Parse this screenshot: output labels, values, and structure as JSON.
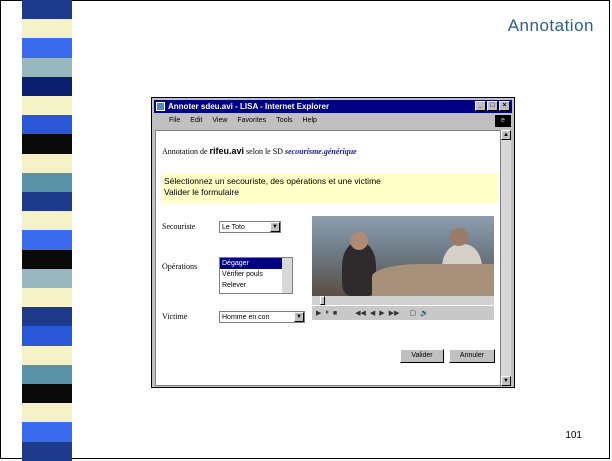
{
  "slide": {
    "title": "Annotation",
    "page_number": "101",
    "sidebar_colors": [
      "#1e3a8a",
      "#f5f2c8",
      "#3b6cf0",
      "#98b8c0",
      "#0a1f6e",
      "#f5f2c8",
      "#2a56d8",
      "#0a0a0a",
      "#f5f2c8",
      "#5a92a8",
      "#1e3a8a",
      "#f5f2c8",
      "#3b6cf0",
      "#0a0a0a",
      "#98b8c0",
      "#f5f2c8",
      "#1e3a8a",
      "#2a56d8",
      "#f5f2c8",
      "#5a92a8",
      "#0a0a0a",
      "#f5f2c8",
      "#3b6cf0",
      "#1e3a8a"
    ]
  },
  "window": {
    "title": "Annoter sdeu.avi - LISA - Internet Explorer",
    "controls": [
      "_",
      "□",
      "×"
    ],
    "menu": [
      "File",
      "Edit",
      "View",
      "Favorites",
      "Tools",
      "Help"
    ]
  },
  "page": {
    "annotation_prefix": "Annotation de",
    "file_name": "rifeu.avi",
    "annotation_middle": "selon le SD",
    "sd_name": "secourisme.générique",
    "instruction_line1": "Sélectionnez un secouriste, des opérations et une victime",
    "instruction_line2": "Valider le formulaire",
    "secouriste_label": "Secouriste",
    "secouriste_value": "Le Toto",
    "operations_label": "Opérations",
    "operations_options": [
      "Dégager",
      "Vérifier pouls",
      "Relever"
    ],
    "victime_label": "Victime",
    "victime_value": "Homme en con",
    "validate_button": "Valider",
    "cancel_button": "Annuler"
  },
  "player": {
    "controls": [
      "▶",
      "⏸",
      "■",
      "◀◀",
      "◀",
      "▶",
      "▶▶",
      "▢",
      "🔊"
    ]
  }
}
